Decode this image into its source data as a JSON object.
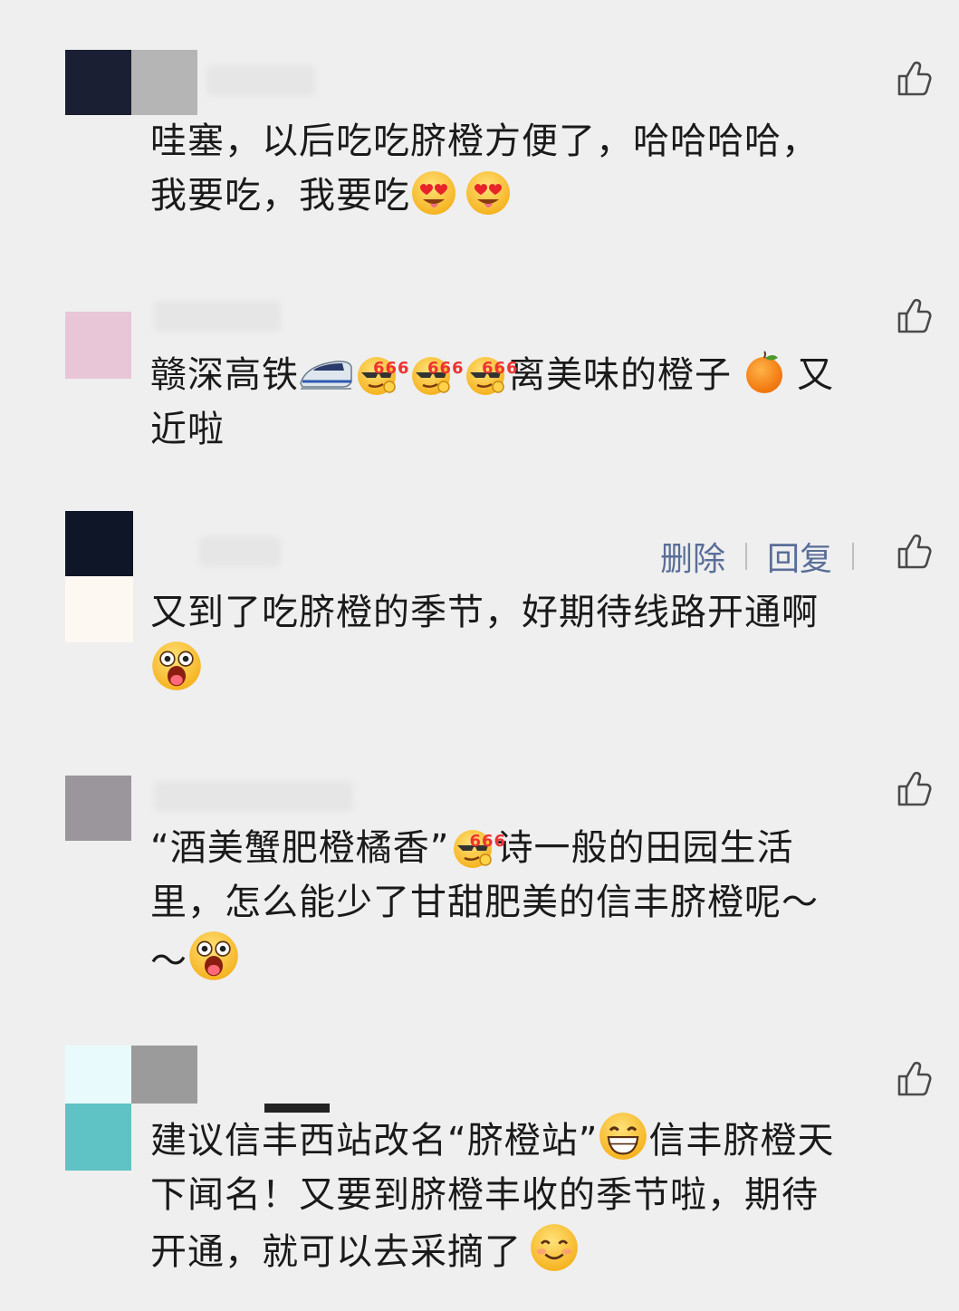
{
  "comments": [
    {
      "id": "c1",
      "avatar_colors": [
        "#1a1f33",
        "#b5b5b5"
      ],
      "text_1": "哇塞，以后吃吃脐橙方便了，哈哈哈哈，",
      "text_2": "我要吃，我要吃",
      "emojis": [
        "heart-eyes",
        "heart-eyes"
      ]
    },
    {
      "id": "c2",
      "avatar_colors": [
        "#e8c6d8"
      ],
      "text_1": "赣深高铁",
      "text_2": "离美味的橙子",
      "text_3": "又",
      "text_4": "近啦",
      "emojis": [
        "bullet-train",
        "666-cool",
        "666-cool",
        "666-cool",
        "orange"
      ],
      "badge_text": "666"
    },
    {
      "id": "c3",
      "avatar_colors": [
        "#0e1628",
        "#fdf8f2"
      ],
      "actions": {
        "delete_label": "删除",
        "reply_label": "回复"
      },
      "text_1": "又到了吃脐橙的季节，好期待线路开通啊",
      "emojis": [
        "excited-face"
      ]
    },
    {
      "id": "c4",
      "avatar_colors": [
        "#9a969b"
      ],
      "text_1": "“酒美蟹肥橙橘香”",
      "text_2": "诗一般的田园生活",
      "text_3": "里，怎么能少了甘甜肥美的信丰脐橙呢～",
      "text_4": "～",
      "emojis": [
        "666-cool",
        "excited-face"
      ],
      "badge_text": "666"
    },
    {
      "id": "c5",
      "avatar_colors": [
        "#e8fafb",
        "#9b9b9b",
        "#5fc2c4"
      ],
      "text_1": "建议信丰西站改名“脐橙站”",
      "text_2": "信丰脐橙天",
      "text_3": "下闻名！又要到脐橙丰收的季节啦，期待",
      "text_4": "开通，就可以去采摘了",
      "emojis": [
        "grinning-face",
        "smiling-face"
      ]
    }
  ],
  "colors": {
    "background": "#efefef",
    "text": "#1a1a1a",
    "action_link": "#5a6e98",
    "like_icon": "#4a4a4a"
  }
}
